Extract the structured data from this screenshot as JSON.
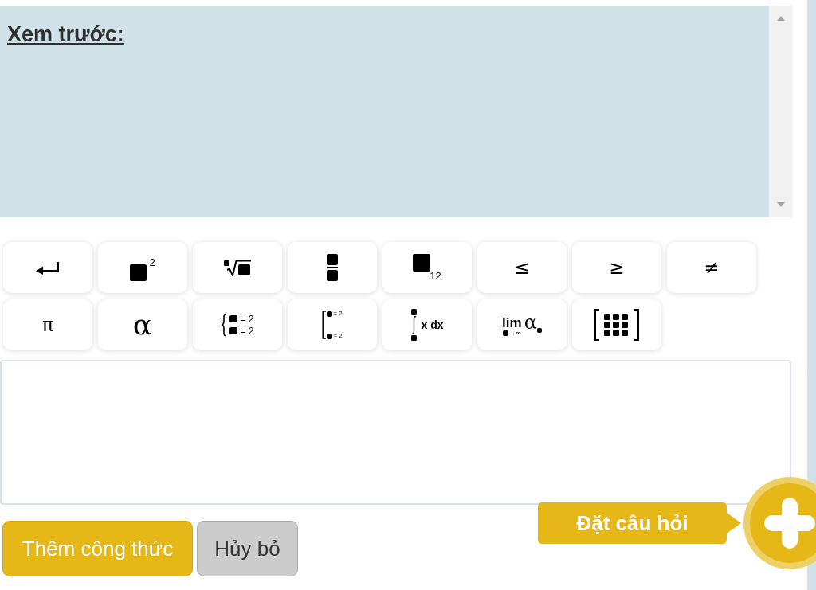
{
  "preview": {
    "heading": "Xem trước:"
  },
  "toolbar": {
    "buttons": [
      {
        "kind": "enter"
      },
      {
        "kind": "power",
        "text": "2"
      },
      {
        "kind": "root"
      },
      {
        "kind": "fraction"
      },
      {
        "kind": "subscript",
        "text": "12"
      },
      {
        "kind": "symbol",
        "text": "≤"
      },
      {
        "kind": "symbol",
        "text": "≥"
      },
      {
        "kind": "symbol",
        "text": "≠"
      },
      {
        "kind": "symbol",
        "text": "π"
      },
      {
        "kind": "greek",
        "text": "α"
      },
      {
        "kind": "system",
        "lines": [
          "= 2",
          "= 2"
        ]
      },
      {
        "kind": "bracket",
        "lines": [
          "= 2",
          "= 2"
        ]
      },
      {
        "kind": "integral",
        "text": "x dx"
      },
      {
        "kind": "limit",
        "text": "lim",
        "subscript": "→∞",
        "variable": "α"
      },
      {
        "kind": "matrix"
      }
    ]
  },
  "actions": [
    {
      "label": "Thêm công thức",
      "kind": "primary"
    },
    {
      "label": "Hủy bỏ",
      "kind": "secondary"
    }
  ],
  "ask_question": {
    "label": "Đặt câu hỏi"
  }
}
